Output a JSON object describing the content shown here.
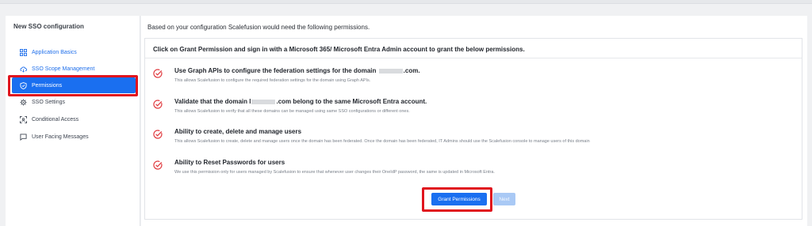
{
  "sidebar": {
    "title": "New SSO configuration",
    "items": [
      {
        "label": "Application Basics",
        "icon": "grid-icon"
      },
      {
        "label": "SSO Scope Management",
        "icon": "cloud-icon"
      },
      {
        "label": "Permissions",
        "icon": "shield-icon"
      },
      {
        "label": "SSO Settings",
        "icon": "gear-icon"
      },
      {
        "label": "Conditional Access",
        "icon": "frame-icon"
      },
      {
        "label": "User Facing Messages",
        "icon": "message-icon"
      }
    ]
  },
  "main": {
    "header": "Based on your configuration Scalefusion would need the following permissions.",
    "card_title": "Click on Grant Permission and sign in with a Microsoft 365/ Microsoft Entra Admin account to grant the below permissions.",
    "permissions": [
      {
        "title_prefix": "Use Graph APIs to configure the federation settings for the domain",
        "title_suffix": ".com.",
        "desc": "This allows Scalefusion to configure the required federation settings for the domain using Graph APIs."
      },
      {
        "title_prefix": "Validate that the domain l",
        "title_suffix": ".com belong to the same Microsoft Entra account.",
        "desc": "This allows Scalefusion to verify that all these domains can be managed using same SSO configurations or different ones."
      },
      {
        "title": "Ability to create, delete and manage users",
        "desc": "This allows Scalefusion to create, delete and manage users once the domain has been federated. Once the domain has been federated, IT Admins should use the Scalefusion console to manage users of this domain"
      },
      {
        "title": "Ability to Reset Passwords for users",
        "desc": "We use this permission only for users managed by Scalefusion to ensure that whenever user changes their OneIdP password, the same is updated in Microsoft Entra."
      }
    ],
    "grant_button": "Grant Permissions",
    "next_button": "Next"
  },
  "colors": {
    "accent": "#1a6ff0",
    "highlight": "#e0141e",
    "check": "#e0393e"
  }
}
